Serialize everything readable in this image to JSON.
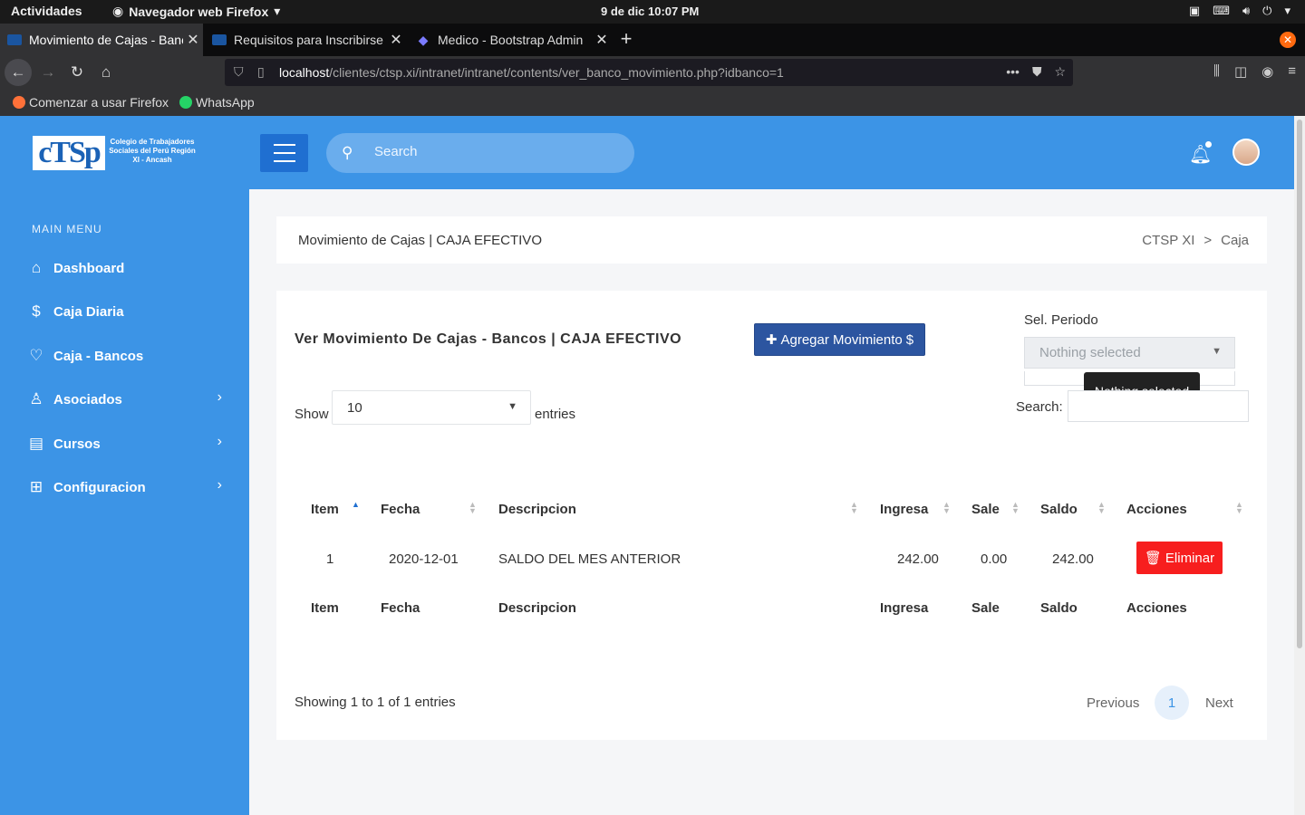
{
  "system": {
    "activities": "Actividades",
    "app_name": "Navegador web Firefox",
    "clock": "9 de dic  10:07 PM"
  },
  "browser": {
    "tabs": [
      {
        "title": "Movimiento de Cajas - Banc"
      },
      {
        "title": "Requisitos para Inscribirse"
      },
      {
        "title": "Medico - Bootstrap Admin"
      }
    ],
    "url_host": "localhost",
    "url_path": "/clientes/ctsp.xi/intranet/intranet/contents/ver_banco_movimiento.php?idbanco=1",
    "bookmarks": [
      {
        "label": "Comenzar a usar Firefox"
      },
      {
        "label": "WhatsApp"
      }
    ]
  },
  "header": {
    "logo_text": "cTSp",
    "logo_caption": "Colegio de Trabajadores Sociales del Perú Región XI - Ancash",
    "search_placeholder": "Search"
  },
  "sidebar": {
    "title": "MAIN MENU",
    "items": [
      {
        "label": "Dashboard",
        "icon": "home-icon"
      },
      {
        "label": "Caja Diaria",
        "icon": "dollar-icon"
      },
      {
        "label": "Caja - Bancos",
        "icon": "heart-icon"
      },
      {
        "label": "Asociados",
        "icon": "user-icon"
      },
      {
        "label": "Cursos",
        "icon": "document-icon"
      },
      {
        "label": "Configuracion",
        "icon": "grid-icon"
      }
    ]
  },
  "breadcrumb": {
    "title": "Movimiento de Cajas | CAJA EFECTIVO",
    "crumb_1": "CTSP XI",
    "separator": ">",
    "crumb_2": "Caja"
  },
  "card": {
    "title": "Ver Movimiento De Cajas - Bancos | CAJA EFECTIVO",
    "add_button": "Agregar Movimiento",
    "periodo_label": "Sel. Periodo",
    "periodo_value": "Nothing selected",
    "tooltip": "Nothing selected",
    "show_label": "Show",
    "length_value": "10",
    "entries_label": "entries",
    "search_label": "Search:"
  },
  "table": {
    "columns": [
      "Item",
      "Fecha",
      "Descripcion",
      "Ingresa",
      "Sale",
      "Saldo",
      "Acciones"
    ],
    "rows": [
      {
        "item": "1",
        "fecha": "2020-12-01",
        "descripcion": "SALDO DEL MES ANTERIOR",
        "ingresa": "242.00",
        "sale": "0.00",
        "saldo": "242.00",
        "accion": "Eliminar"
      }
    ],
    "info": "Showing 1 to 1 of 1 entries",
    "pagination": {
      "previous": "Previous",
      "page": "1",
      "next": "Next"
    }
  },
  "colors": {
    "primary_blue": "#3c94e6",
    "button_navy": "#2c55a0",
    "danger_red": "#f71e1e"
  }
}
